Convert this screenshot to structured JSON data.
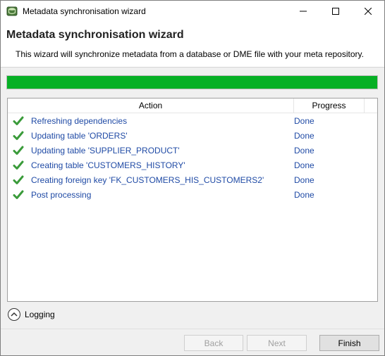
{
  "window": {
    "title": "Metadata synchronisation wizard",
    "icons": {
      "app": "wizard-app-icon",
      "minimize": "minimize-icon",
      "maximize": "maximize-icon",
      "close": "close-icon"
    }
  },
  "header": {
    "title": "Metadata synchronisation wizard",
    "description": "This wizard will synchronize metadata from a database or DME file with your meta repository."
  },
  "progress": {
    "fraction": 1.0,
    "color": "#06b025"
  },
  "table": {
    "columns": {
      "action": "Action",
      "progress": "Progress"
    },
    "rows": [
      {
        "action": "Refreshing dependencies",
        "progress": "Done",
        "status_icon": "checkmark-icon"
      },
      {
        "action": "Updating table 'ORDERS'",
        "progress": "Done",
        "status_icon": "checkmark-icon"
      },
      {
        "action": "Updating table 'SUPPLIER_PRODUCT'",
        "progress": "Done",
        "status_icon": "checkmark-icon"
      },
      {
        "action": "Creating table 'CUSTOMERS_HISTORY'",
        "progress": "Done",
        "status_icon": "checkmark-icon"
      },
      {
        "action": "Creating foreign key 'FK_CUSTOMERS_HIS_CUSTOMERS2'",
        "progress": "Done",
        "status_icon": "checkmark-icon"
      },
      {
        "action": "Post processing",
        "progress": "Done",
        "status_icon": "checkmark-icon"
      }
    ],
    "text_color": "#1f4aa5",
    "check_color": "#3a9b3a"
  },
  "logging": {
    "label": "Logging",
    "icon": "chevron-up-icon"
  },
  "buttons": {
    "back": "Back",
    "next": "Next",
    "finish": "Finish"
  }
}
